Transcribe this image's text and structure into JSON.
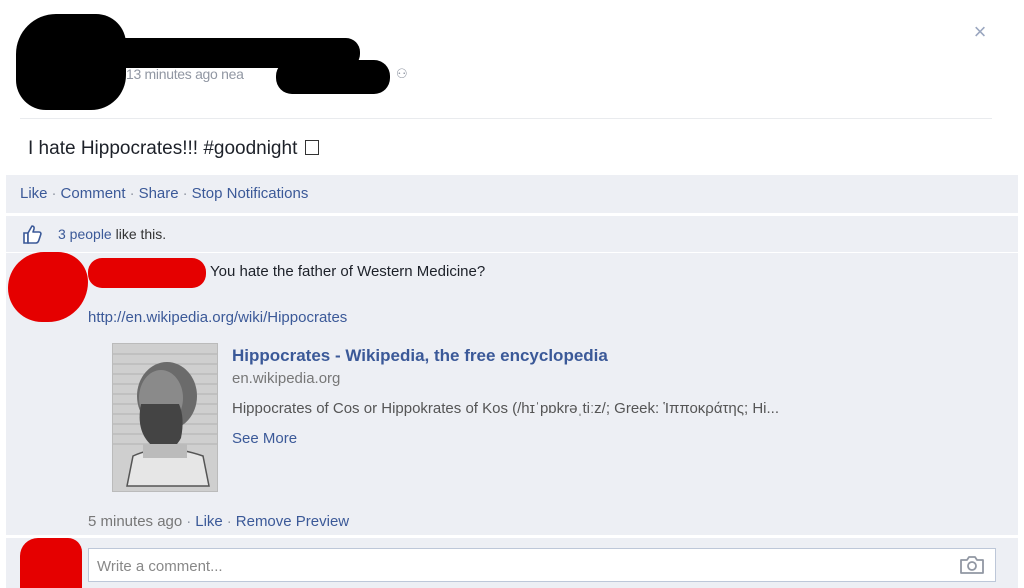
{
  "post": {
    "close_glyph": "×",
    "timestamp": "13 minutes ago nea",
    "privacy_glyph": "⚇",
    "text": "I hate Hippocrates!!! #goodnight"
  },
  "actions": {
    "like": "Like",
    "comment": "Comment",
    "share": "Share",
    "stop_notifications": "Stop Notifications",
    "separator": "·"
  },
  "likes": {
    "count_text": "3 people",
    "suffix": " like this."
  },
  "comment": {
    "text": "You hate the father of Western Medicine?",
    "link": "http://en.wikipedia.org/wiki/Hippocrates",
    "preview": {
      "title": "Hippocrates - Wikipedia, the free encyclopedia",
      "domain": "en.wikipedia.org",
      "description": "Hippocrates of Cos or Hippokrates of Kos (/hɪˈpɒkrəˌtiːz/; Greek: Ἱπποκράτης; Hi...",
      "see_more": "See More"
    },
    "time": "5 minutes ago",
    "like": "Like",
    "remove_preview": "Remove Preview"
  },
  "write_comment": {
    "placeholder": "Write a comment..."
  },
  "colors": {
    "link": "#3b5998",
    "feedback_bg": "#edeff4",
    "redaction_black": "#000000",
    "redaction_red": "#e50000"
  },
  "icons": {
    "close": "close-icon",
    "privacy": "friends-icon",
    "like": "thumbs-up-icon",
    "camera": "camera-icon"
  }
}
